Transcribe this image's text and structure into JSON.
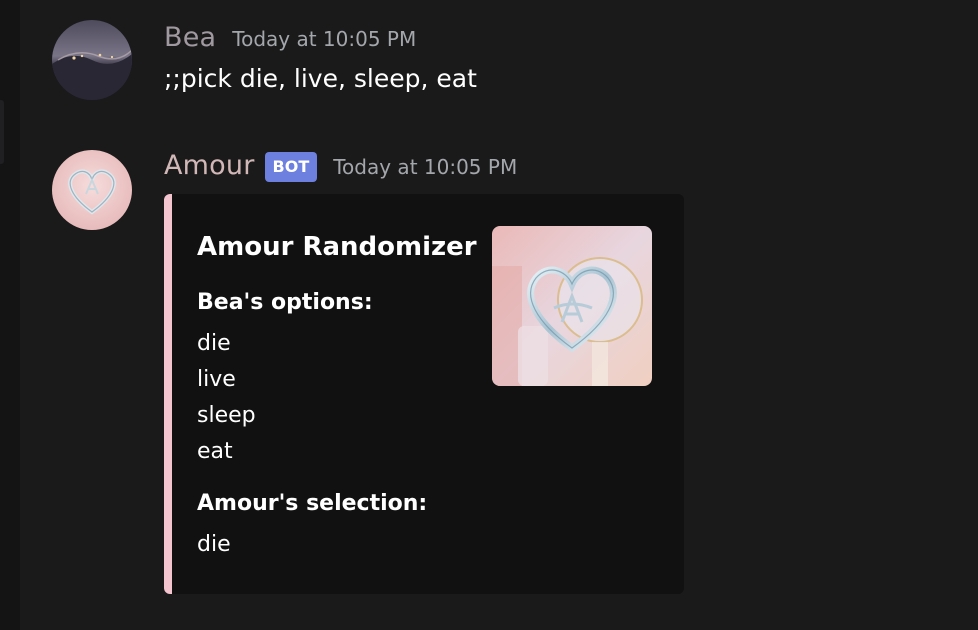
{
  "messages": [
    {
      "author": "Bea",
      "author_color": "#a0999f",
      "timestamp": "Today at 10:05 PM",
      "content": ";;pick die, live, sleep, eat"
    },
    {
      "author": "Amour",
      "author_color": "#d2b7b7",
      "is_bot": true,
      "bot_tag": "BOT",
      "timestamp": "Today at 10:05 PM",
      "embed": {
        "accent_color": "#f5c5cf",
        "title": "Amour Randomizer",
        "options_label": "Bea's options:",
        "options": [
          "die",
          "live",
          "sleep",
          "eat"
        ],
        "selection_label": "Amour's selection:",
        "selection": "die"
      }
    }
  ],
  "icons": {
    "bea_avatar": "avatar-image",
    "amour_avatar": "heart-logo-icon",
    "thumbnail": "heart-logo-icon"
  }
}
